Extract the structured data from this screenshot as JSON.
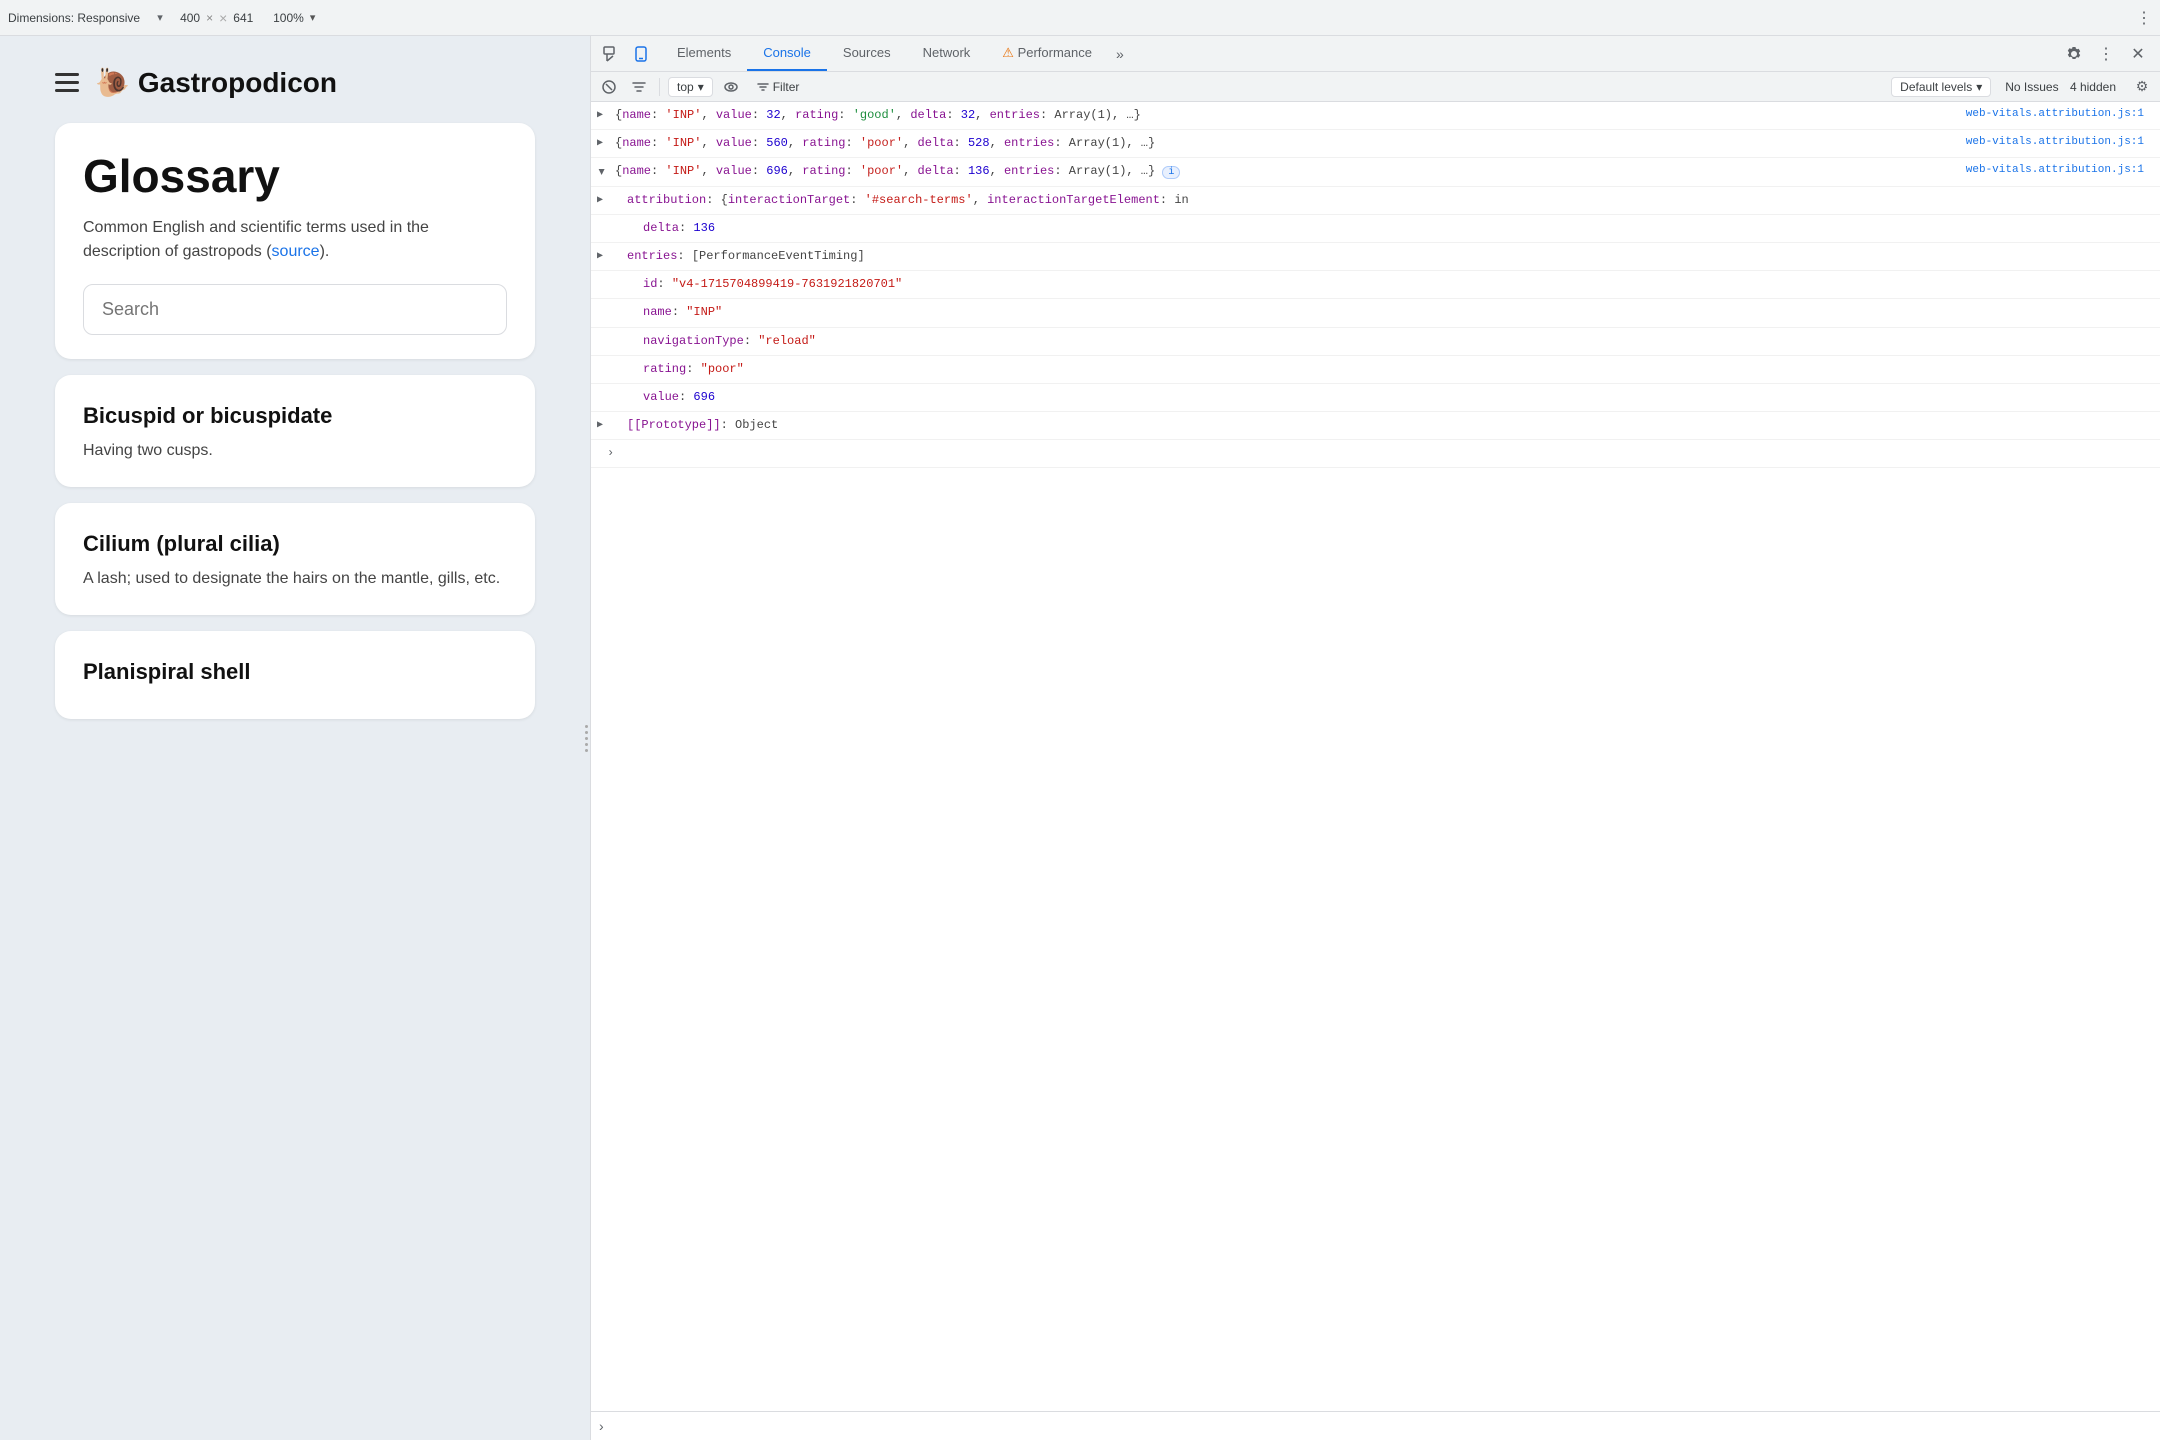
{
  "topbar": {
    "dimensions_label": "Dimensions: Responsive",
    "width": "400",
    "close_x": "×",
    "height": "641",
    "zoom": "100%",
    "more": "⋮"
  },
  "website": {
    "site_title": "Gastropodicon",
    "snail": "🐌",
    "glossary_heading": "Glossary",
    "glossary_desc_prefix": "Common English and scientific terms used in the description of gastropods (",
    "glossary_source_link": "source",
    "glossary_desc_suffix": ").",
    "search_placeholder": "Search",
    "terms": [
      {
        "title": "Bicuspid or bicuspidate",
        "definition": "Having two cusps."
      },
      {
        "title": "Cilium (plural cilia)",
        "definition": "A lash; used to designate the hairs on the mantle, gills, etc."
      },
      {
        "title": "Planispiral shell",
        "definition": ""
      }
    ]
  },
  "devtools": {
    "tabs": [
      {
        "label": "Elements",
        "active": false
      },
      {
        "label": "Console",
        "active": true
      },
      {
        "label": "Sources",
        "active": false
      },
      {
        "label": "Network",
        "active": false
      },
      {
        "label": "Performance",
        "active": false
      }
    ],
    "tab_more": "»",
    "context": "top",
    "filter_label": "Filter",
    "level_label": "Default levels",
    "no_issues": "No Issues",
    "hidden_count": "4 hidden",
    "console_entries": [
      {
        "id": "entry1",
        "collapsed": true,
        "file": "web-vitals.attribution.js:1",
        "content": "{name: 'INP', value: 32, rating: 'good', delta: 32, entries: Array(1), …}"
      },
      {
        "id": "entry2",
        "collapsed": true,
        "file": "web-vitals.attribution.js:1",
        "content": "{name: 'INP', value: 560, rating: 'poor', delta: 528, entries: Array(1), …}"
      },
      {
        "id": "entry3",
        "collapsed": false,
        "file": "web-vitals.attribution.js:1",
        "main": "{name: 'INP', value: 696, rating: 'poor', delta: 136, entries: Array(1), …}",
        "has_info": true,
        "children": [
          {
            "key": "attribution",
            "value": "{interactionTarget: '#search-terms', interactionTargetElement: in",
            "collapsed": true
          },
          {
            "key": "delta",
            "value": "136",
            "type": "num",
            "indent": 2
          },
          {
            "key": "entries",
            "value": "[PerformanceEventTiming]",
            "collapsed": true
          },
          {
            "key": "id",
            "value": "\"v4-1715704899419-7631921820701\"",
            "type": "str",
            "indent": 2
          },
          {
            "key": "name",
            "value": "\"INP\"",
            "type": "str",
            "indent": 2
          },
          {
            "key": "navigationType",
            "value": "\"reload\"",
            "type": "str",
            "indent": 2
          },
          {
            "key": "rating",
            "value": "\"poor\"",
            "type": "str",
            "indent": 2
          },
          {
            "key": "value",
            "value": "696",
            "type": "num",
            "indent": 2
          },
          {
            "key": "[[Prototype]]",
            "value": "Object",
            "type": "obj",
            "collapsed": true
          }
        ]
      }
    ],
    "prompt_placeholder": ""
  }
}
